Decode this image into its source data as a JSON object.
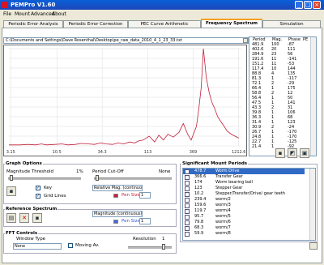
{
  "window": {
    "title": "PEMPro V1.60"
  },
  "menu": [
    "File",
    "Mount",
    "Advanced",
    "About"
  ],
  "tabs": [
    "Periodic Error Analysis",
    "Periodic Error Correction",
    "PEC Curve Arithmetic",
    "Frequency Spectrum",
    "Simulation"
  ],
  "file_path": "C:\\Documents and Settings\\Dave Rosenthal\\Desktop\\pe_raw_data_2010_4_1_23_33.txt",
  "spectrum_list": {
    "headers": {
      "period": "Period",
      "mag": "Mag.",
      "phase": "Phase",
      "pe": "PE"
    },
    "rows": [
      [
        "481.9",
        "100",
        "-87"
      ],
      [
        "402.6",
        "20",
        "111"
      ],
      [
        "284.9",
        "23",
        "56"
      ],
      [
        "191.6",
        "11",
        "-141"
      ],
      [
        "151.2",
        "11",
        "-53"
      ],
      [
        "117.4",
        "10",
        "144"
      ],
      [
        "88.8",
        "4",
        "135"
      ],
      [
        "81.3",
        "1",
        "-117"
      ],
      [
        "72.1",
        "2",
        "-29"
      ],
      [
        "66.4",
        "1",
        "175"
      ],
      [
        "58.8",
        "2",
        "12"
      ],
      [
        "56.4",
        "1",
        "50"
      ],
      [
        "47.5",
        "1",
        "141"
      ],
      [
        "43.3",
        "2",
        "31"
      ],
      [
        "39.8",
        "1",
        "106"
      ],
      [
        "36.3",
        "1",
        "68"
      ],
      [
        "31.4",
        "1",
        "123"
      ],
      [
        "30.9",
        "2",
        "-24"
      ],
      [
        "26.7",
        "1",
        "-170"
      ],
      [
        "24.8",
        "1",
        "-170"
      ],
      [
        "22.7",
        "1",
        "-125"
      ],
      [
        "21.4",
        "1",
        "-92"
      ]
    ]
  },
  "chart_data": {
    "type": "line",
    "x_tick_labels": [
      "3.15",
      "10.5",
      "34.3",
      "113",
      "369",
      "1212.6"
    ],
    "x": [
      3,
      4,
      5,
      6,
      7,
      8,
      10,
      12,
      14,
      17,
      20,
      24,
      28,
      33,
      38,
      45,
      52,
      60,
      70,
      80,
      88,
      100,
      117,
      135,
      151,
      170,
      191,
      220,
      255,
      285,
      320,
      350,
      402,
      430,
      455,
      482,
      520,
      560,
      600,
      650,
      700,
      760,
      830,
      900,
      1000,
      1100,
      1212
    ],
    "values": [
      1,
      1,
      1.5,
      1,
      2,
      1,
      1.5,
      2,
      1,
      1.5,
      2.5,
      2,
      1.5,
      3,
      2,
      1.5,
      3,
      2,
      4,
      3,
      5,
      6,
      10,
      4,
      11,
      6,
      12,
      9,
      14,
      23,
      12,
      6,
      20,
      40,
      60,
      100,
      70,
      55,
      45,
      38,
      30,
      25,
      20,
      15,
      12,
      10,
      8
    ],
    "ylim": [
      0,
      100
    ],
    "grid": true,
    "line_color": "#c21e3a"
  },
  "graph_options": {
    "title": "Graph Options",
    "mag_threshold_label": "Magnitude Threshold",
    "mag_threshold_value": "1%",
    "period_cutoff_label": "Period Cut-Off",
    "period_cutoff_value": "None",
    "key_label": "Key",
    "gridlines_label": "Grid Lines",
    "relative_mag_select": "Relative Mag. (continuous)",
    "pen_size_label": "Pen Size",
    "pen_size_value": "1"
  },
  "reference_spectrum": {
    "title": "Reference Spectrum",
    "mag_select": "Magnitude (continuous)",
    "pen_size_label": "Pen Size",
    "pen_size_value": "1"
  },
  "fft_controls": {
    "title": "FFT Controls",
    "window_type_label": "Window Type",
    "window_type_value": "None",
    "moving_avg_label": "Moving Av.",
    "resolution_label": "Resolution",
    "resolution_value": "1"
  },
  "significant_periods": {
    "title": "Significant Mount Periods",
    "rows": [
      {
        "period": "478.7",
        "desc": "Worm Drive"
      },
      {
        "period": "366.6",
        "desc": "Transfer Gear"
      },
      {
        "period": "174",
        "desc": "Worm bearing ball"
      },
      {
        "period": "123",
        "desc": "Stepper Gear"
      },
      {
        "period": "10.2",
        "desc": "Stepper/Transfer/Drive/ gear teeth"
      },
      {
        "period": "239.4",
        "desc": "worm/2"
      },
      {
        "period": "159.6",
        "desc": "worm/3"
      },
      {
        "period": "119.7",
        "desc": "worm/4"
      },
      {
        "period": "95.7",
        "desc": "worm/5"
      },
      {
        "period": "79.8",
        "desc": "worm/6"
      },
      {
        "period": "68.3",
        "desc": "worm/7"
      },
      {
        "period": "59.9",
        "desc": "worm/8"
      }
    ]
  }
}
